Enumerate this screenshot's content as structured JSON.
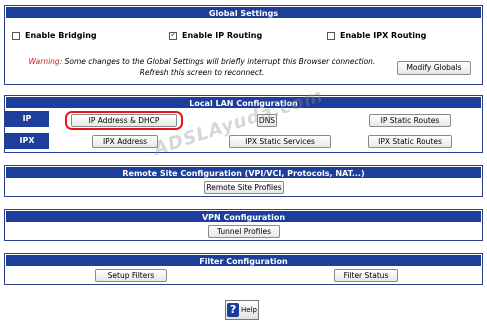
{
  "global": {
    "title": "Global Settings",
    "bridging_label": "Enable Bridging",
    "bridging_checked": false,
    "ip_routing_label": "Enable IP Routing",
    "ip_routing_checked": true,
    "ipx_routing_label": "Enable IPX Routing",
    "ipx_routing_checked": false,
    "warning_prefix": "Warning:",
    "warning_line1": " Some changes to the Global Settings will briefly interrupt this Browser connection.",
    "warning_line2": "Refresh this screen to reconnect.",
    "modify_button": "Modify Globals"
  },
  "lan": {
    "title": "Local LAN Configuration",
    "ip_label": "IP",
    "ipx_label": "IPX",
    "ip_address_dhcp": "IP Address & DHCP",
    "dns": "DNS",
    "ip_static_routes": "IP Static Routes",
    "ipx_address": "IPX Address",
    "ipx_static_services": "IPX Static Services",
    "ipx_static_routes": "IPX Static Routes"
  },
  "remote": {
    "title": "Remote Site Configuration (VPI/VCI, Protocols, NAT...)",
    "profiles_button": "Remote Site Profiles"
  },
  "vpn": {
    "title": "VPN Configuration",
    "tunnel_button": "Tunnel Profiles"
  },
  "filter": {
    "title": "Filter Configuration",
    "setup_button": "Setup Filters",
    "status_button": "Filter Status"
  },
  "help": {
    "label": "Help",
    "icon": "question-icon"
  },
  "watermark": "ADSLAyuda.com",
  "colors": {
    "header_bar": "#1d3f9b",
    "highlight": "#e0161b",
    "warning": "#cc1a1a"
  }
}
